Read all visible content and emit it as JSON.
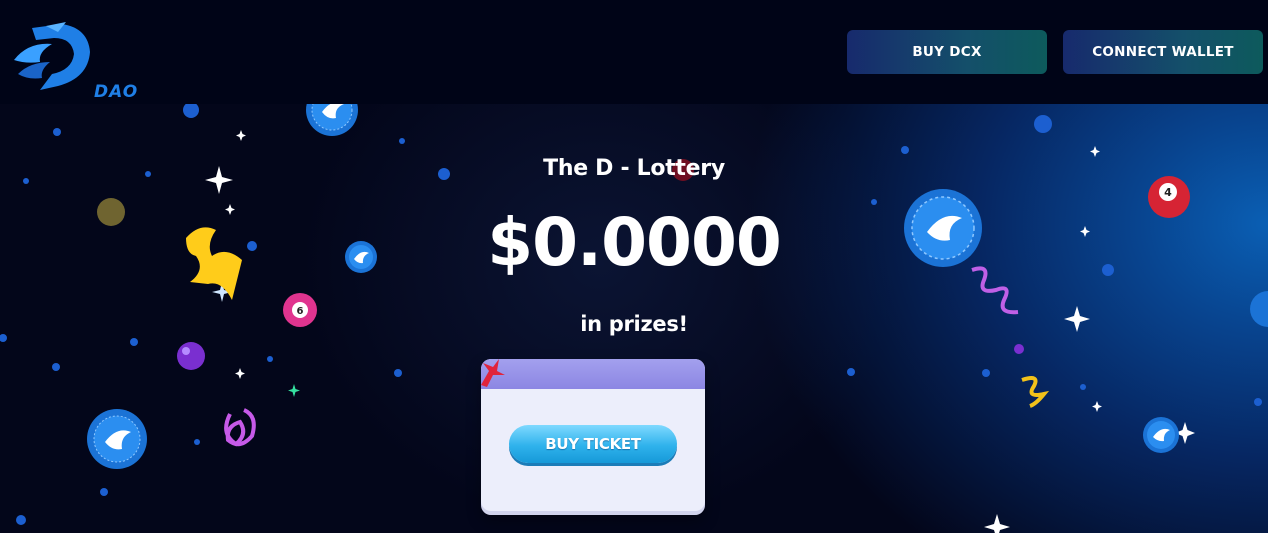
{
  "header": {
    "logo_text": "DAO",
    "buy_label": "BUY DCX",
    "connect_label": "CONNECT WALLET"
  },
  "hero": {
    "title": "The D - Lottery",
    "prize_amount": "$0.0000",
    "prize_suffix": "in prizes!",
    "ticket_button_label": "BUY TICKET"
  },
  "colors": {
    "background": "#03061a",
    "accent_blue": "#1f7fe6",
    "button_gradient_start": "#172a6d",
    "button_gradient_end": "#0d5a5c",
    "ticket_button": "#2fb2ec"
  },
  "icons": [
    "dragon-logo-icon",
    "coin-icon",
    "lottery-ball-icon",
    "sparkle-icon",
    "confetti-icon",
    "gift-bow-icon"
  ]
}
